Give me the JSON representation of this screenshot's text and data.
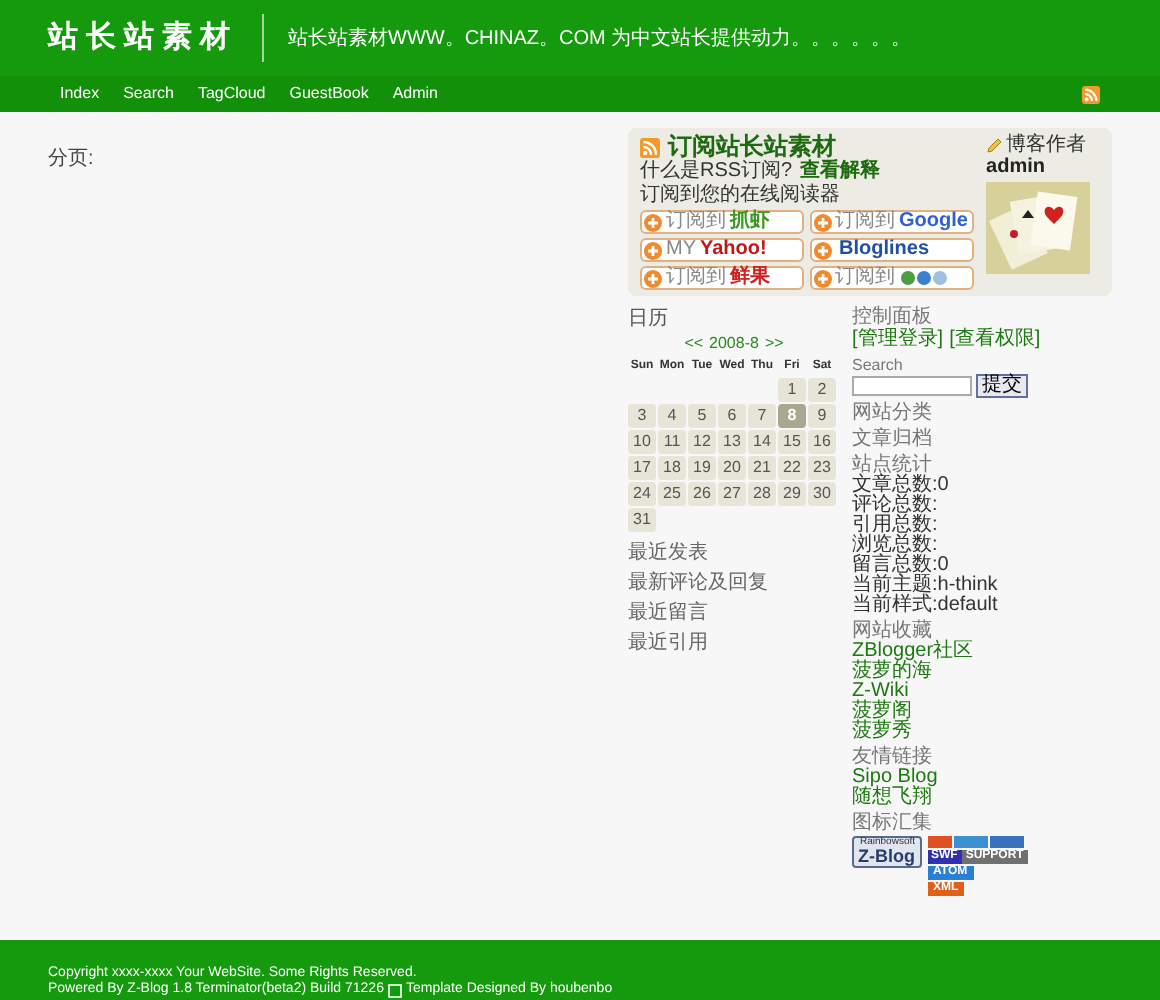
{
  "header": {
    "title": "站长站素材",
    "tagline": "站长站素材WWW。CHINAZ。COM 为中文站长提供动力。。。。。。"
  },
  "nav": [
    "Index",
    "Search",
    "TagCloud",
    "GuestBook",
    "Admin"
  ],
  "content": {
    "text": "分页:"
  },
  "subscribe": {
    "title": "订阅站长站素材",
    "question": "什么是RSS订阅?",
    "help_link": "查看解释",
    "note": "订阅到您的在线阅读器",
    "author_label": "博客作者",
    "author": "admin",
    "buttons": [
      {
        "kind": "text",
        "prefix": "订阅到",
        "service": "抓虾",
        "color": "#3a9a20"
      },
      {
        "kind": "text",
        "prefix": "订阅到",
        "service": "Google",
        "color": "#3060d0"
      },
      {
        "kind": "text",
        "prefix": "MY",
        "service": "Yahoo!",
        "color": "#c01818"
      },
      {
        "kind": "text",
        "service": "Bloglines",
        "color": "#2050a0"
      },
      {
        "kind": "text",
        "prefix": "订阅到",
        "service": "鲜果",
        "color": "#d02020"
      },
      {
        "kind": "icons",
        "prefix": "订阅到"
      }
    ]
  },
  "calendar": {
    "heading": "日历",
    "prev": "<<",
    "month": "2008-8",
    "next": ">>",
    "weekdays": [
      "Sun",
      "Mon",
      "Tue",
      "Wed",
      "Thu",
      "Fri",
      "Sat"
    ],
    "weeks": [
      {
        "right_aligned": true,
        "days": [
          {
            "label": "1",
            "selected": false
          },
          {
            "label": "2",
            "selected": false
          }
        ]
      },
      {
        "days": [
          {
            "label": "3",
            "selected": false
          },
          {
            "label": "4",
            "selected": false
          },
          {
            "label": "5",
            "selected": false
          },
          {
            "label": "6",
            "selected": false
          },
          {
            "label": "7",
            "selected": false
          },
          {
            "label": "8",
            "selected": true
          },
          {
            "label": "9",
            "selected": false
          }
        ]
      },
      {
        "days": [
          {
            "label": "10",
            "selected": false
          },
          {
            "label": "11",
            "selected": false
          },
          {
            "label": "12",
            "selected": false
          },
          {
            "label": "13",
            "selected": false
          },
          {
            "label": "14",
            "selected": false
          },
          {
            "label": "15",
            "selected": false
          },
          {
            "label": "16",
            "selected": false
          }
        ]
      },
      {
        "days": [
          {
            "label": "17",
            "selected": false
          },
          {
            "label": "18",
            "selected": false
          },
          {
            "label": "19",
            "selected": false
          },
          {
            "label": "20",
            "selected": false
          },
          {
            "label": "21",
            "selected": false
          },
          {
            "label": "22",
            "selected": false
          },
          {
            "label": "23",
            "selected": false
          }
        ]
      },
      {
        "days": [
          {
            "label": "24",
            "selected": false
          },
          {
            "label": "25",
            "selected": false
          },
          {
            "label": "26",
            "selected": false
          },
          {
            "label": "27",
            "selected": false
          },
          {
            "label": "28",
            "selected": false
          },
          {
            "label": "29",
            "selected": false
          },
          {
            "label": "30",
            "selected": false
          }
        ]
      },
      {
        "right_aligned": false,
        "days": [
          {
            "label": "31",
            "selected": false
          }
        ]
      }
    ]
  },
  "recent_sections": [
    "最近发表",
    "最新评论及回复",
    "最近留言",
    "最近引用"
  ],
  "sidebar": {
    "control_title": "控制面板",
    "control_links": [
      "[管理登录]",
      "[查看权限]"
    ],
    "search_label": "Search",
    "search_button": "提交",
    "sections": [
      {
        "kind": "heading",
        "title": "网站分类"
      },
      {
        "kind": "heading",
        "title": "文章归档"
      },
      {
        "kind": "stats",
        "title": "站点统计",
        "items": [
          "文章总数:0",
          "评论总数:",
          "引用总数:",
          "浏览总数:",
          "留言总数:0",
          "当前主题:h-think",
          "当前样式:default"
        ]
      },
      {
        "kind": "links",
        "title": "网站收藏",
        "items": [
          "ZBlogger社区",
          "菠萝的海",
          "Z-Wiki",
          "菠萝阁",
          "菠萝秀"
        ]
      },
      {
        "kind": "links",
        "title": "友情链接",
        "items": [
          "Sipo Blog",
          "随想飞翔"
        ]
      },
      {
        "kind": "badges",
        "title": "图标汇集",
        "items": [
          {
            "kind": "zblog",
            "top": "Rainbowsoft",
            "label": "Z-Blog"
          },
          {
            "kind": "strip"
          },
          {
            "kind": "pair",
            "left": "SWF",
            "right": "SUPPORT"
          },
          {
            "kind": "single",
            "label": "ATOM",
            "color": "#2a80d0"
          },
          {
            "kind": "single",
            "label": "XML",
            "color": "#e0601a"
          }
        ]
      }
    ]
  },
  "footer": {
    "copyright": "Copyright xxxx-xxxx Your WebSite. Some Rights Reserved.",
    "powered": "Powered By Z-Blog 1.8 Terminator(beta2) Build 71226",
    "designer": "Template Designed By houbenbo"
  }
}
